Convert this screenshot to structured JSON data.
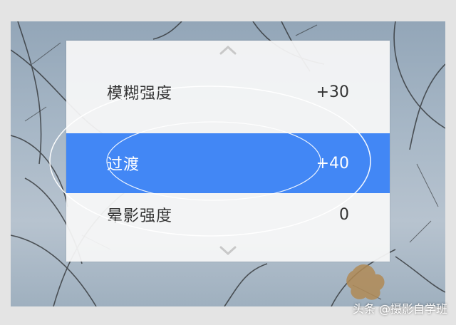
{
  "adjust_panel": {
    "items": [
      {
        "label": "模糊强度",
        "value": "+30"
      },
      {
        "label": "过渡",
        "value": "+40"
      },
      {
        "label": "晕影强度",
        "value": "0"
      }
    ],
    "selected_index": 1,
    "accent_color": "#4287f5"
  },
  "watermark": "头条 @摄影自学班",
  "icons": [
    "chevron-up-icon",
    "chevron-down-icon"
  ]
}
